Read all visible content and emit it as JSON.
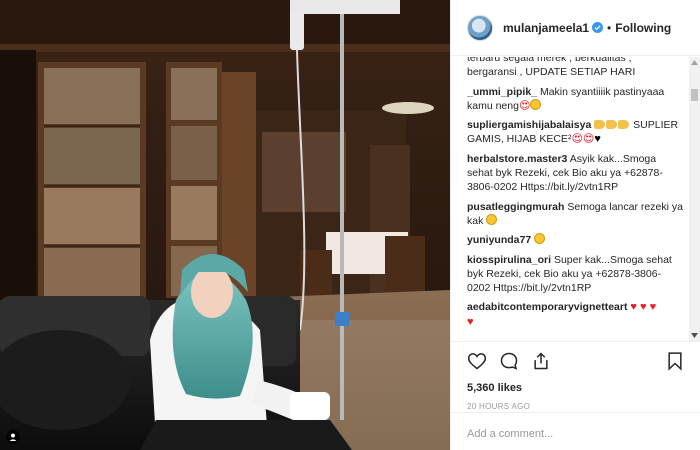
{
  "header": {
    "username": "mulanjameela1",
    "separator": "•",
    "follow_label": "Following"
  },
  "comments": [
    {
      "user": "",
      "text": "terbaru segala merek , berkualitas , bergaransi , UPDATE SETIAP HARI",
      "emojis": []
    },
    {
      "user": "_ummi_pipik_",
      "text": "Makin syantiiiik pastinyaaa kamu neng",
      "emojis": [
        "heart-eyes",
        "smile"
      ]
    },
    {
      "user": "supliergamishijabalaisya",
      "text": "SUPLIER GAMIS, HIJAB KECE²",
      "emojis_before": [
        "hand",
        "hand",
        "hand"
      ],
      "emojis": [
        "heart-eyes",
        "heart-eyes",
        "black-heart"
      ]
    },
    {
      "user": "herbalstore.master3",
      "text": "Asyik kak...Smoga sehat byk Rezeki, cek Bio aku ya +62878-3806-0202 Https://bit.ly/2vtn1RP",
      "emojis": []
    },
    {
      "user": "pusatleggingmurah",
      "text": "Semoga lancar rezeki ya kak",
      "emojis": [
        "smile"
      ]
    },
    {
      "user": "yuniyunda77",
      "text": "",
      "emojis": [
        "smile"
      ]
    },
    {
      "user": "kiosspirulina_ori",
      "text": "Super kak...Smoga sehat byk Rezeki, cek Bio aku ya +62878-3806-0202 Https://bit.ly/2vtn1RP",
      "emojis": []
    },
    {
      "user": "aedabitcontemporaryvignetteart",
      "text": "",
      "emojis": [
        "heart",
        "heart",
        "heart",
        "heart"
      ]
    }
  ],
  "actions": {
    "likes": "5,360 likes",
    "time_ago": "20 HOURS AGO",
    "icons": [
      "heart-icon",
      "comment-icon",
      "share-icon",
      "bookmark-icon"
    ]
  },
  "add_comment": {
    "placeholder": "Add a comment..."
  },
  "colors": {
    "verified": "#3897f0",
    "border": "#efefef",
    "muted": "#999999",
    "hijab": "#5fb0ad"
  }
}
